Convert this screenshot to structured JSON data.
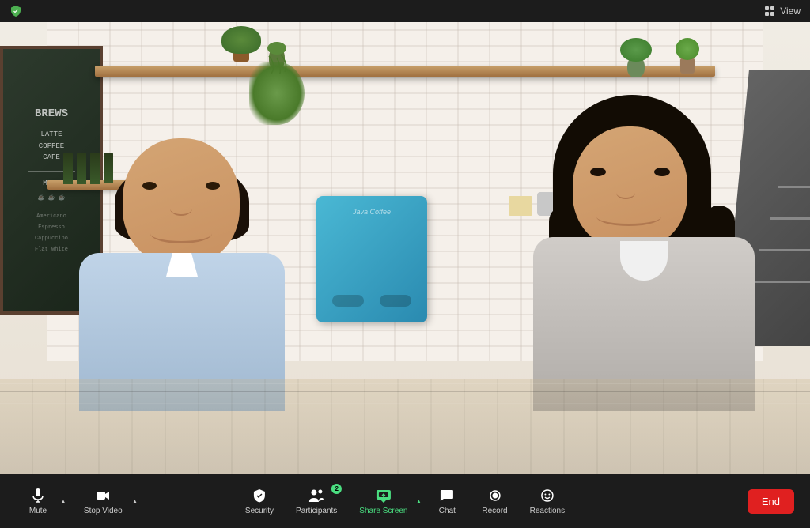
{
  "titlebar": {
    "view_label": "View",
    "shield_color": "#4CAF50"
  },
  "video": {
    "bg_color": "#f0ece4"
  },
  "toolbar": {
    "mute_label": "Mute",
    "stop_video_label": "Stop Video",
    "security_label": "Security",
    "participants_label": "Participants",
    "participants_count": "2",
    "share_screen_label": "Share Screen",
    "chat_label": "Chat",
    "record_label": "Record",
    "reactions_label": "Reactions",
    "end_label": "End"
  },
  "chalkboard": {
    "line1": "BREWS",
    "line2": "LATTE",
    "line3": "COFFEE",
    "line4": "CAFE",
    "line5": "MENU"
  }
}
